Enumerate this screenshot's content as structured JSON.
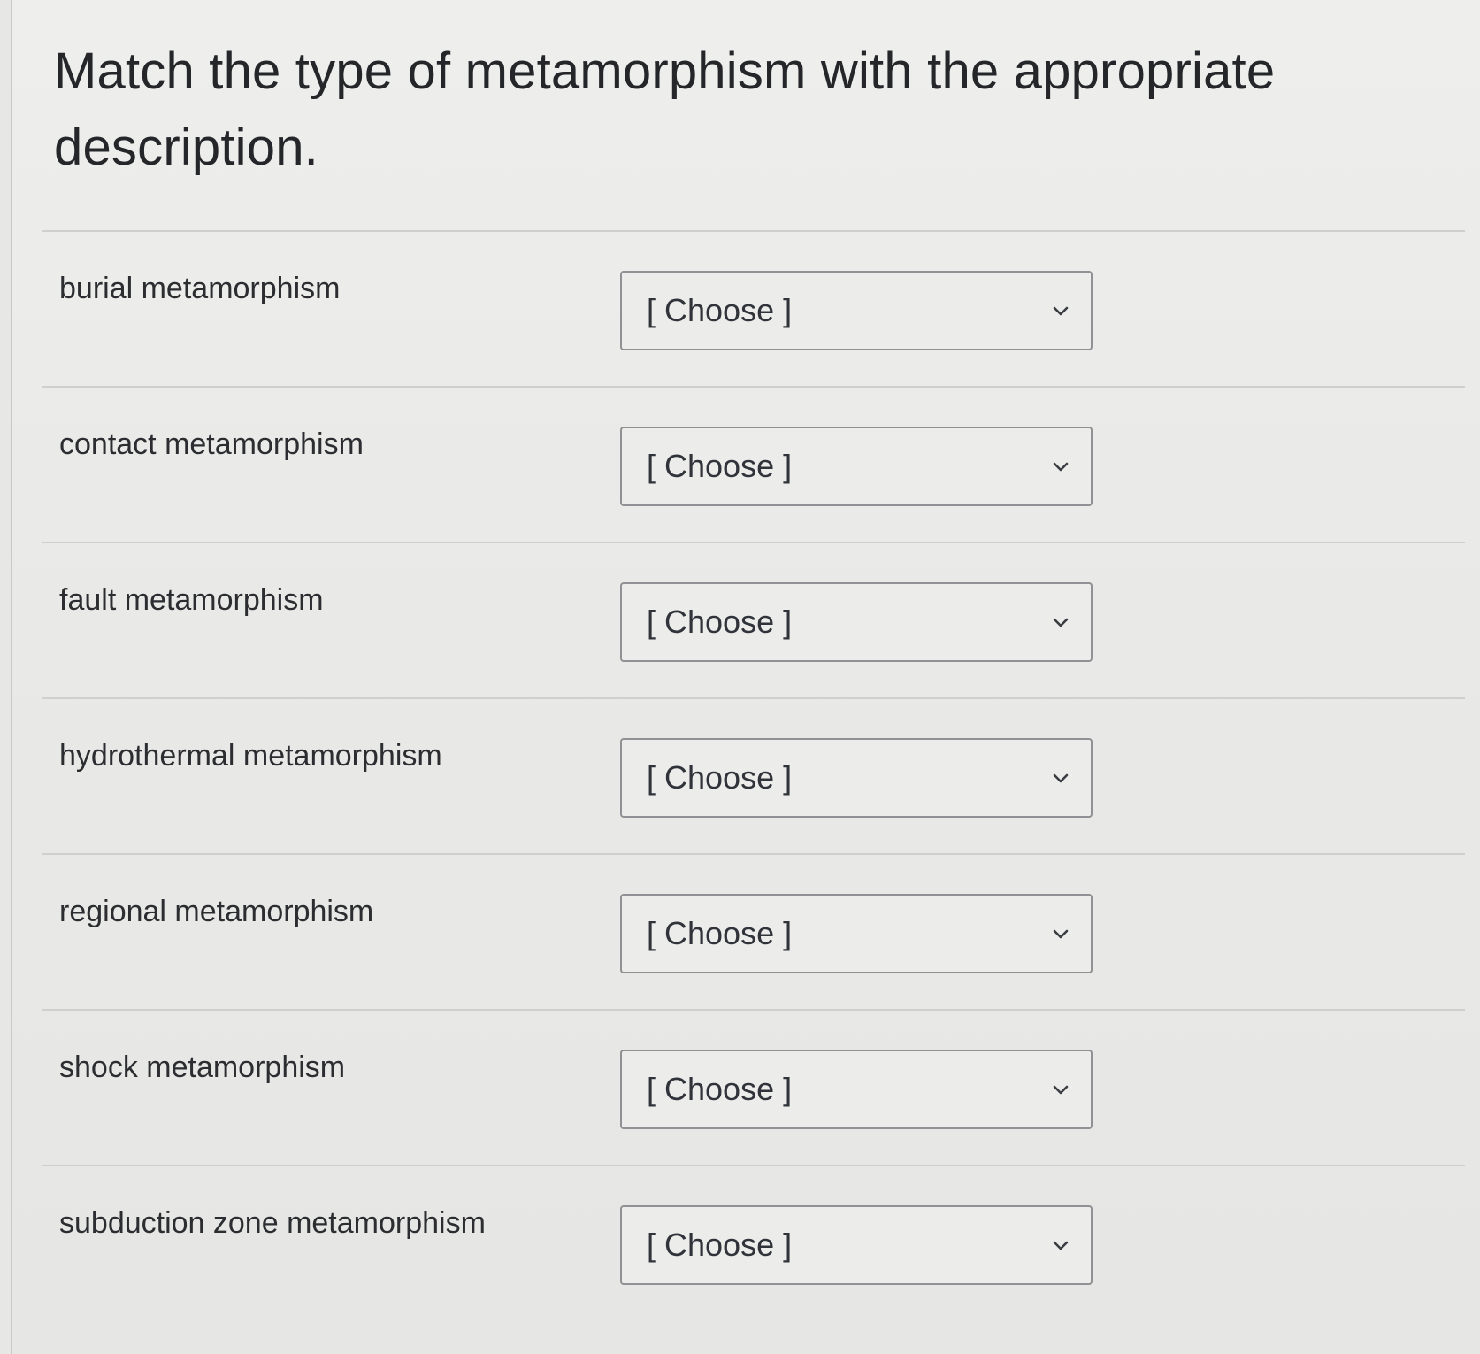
{
  "question": {
    "title": "Match the type of metamorphism with the appropriate description."
  },
  "rows": [
    {
      "term": "burial metamorphism",
      "selected": "[ Choose ]",
      "icon": "chevron-down-icon"
    },
    {
      "term": "contact metamorphism",
      "selected": "[ Choose ]",
      "icon": "chevron-down-icon"
    },
    {
      "term": "fault metamorphism",
      "selected": "[ Choose ]",
      "icon": "chevron-down-icon"
    },
    {
      "term": "hydrothermal metamorphism",
      "selected": "[ Choose ]",
      "icon": "chevron-down-icon"
    },
    {
      "term": "regional metamorphism",
      "selected": "[ Choose ]",
      "icon": "chevron-down-icon"
    },
    {
      "term": "shock metamorphism",
      "selected": "[ Choose ]",
      "icon": "chevron-down-icon"
    },
    {
      "term": "subduction zone metamorphism",
      "selected": "[ Choose ]",
      "icon": "chevron-down-icon"
    }
  ],
  "colors": {
    "background": "#e7e7e5",
    "text": "#2b2d31",
    "divider": "#cfcfcc",
    "select_border": "#8f9195"
  }
}
